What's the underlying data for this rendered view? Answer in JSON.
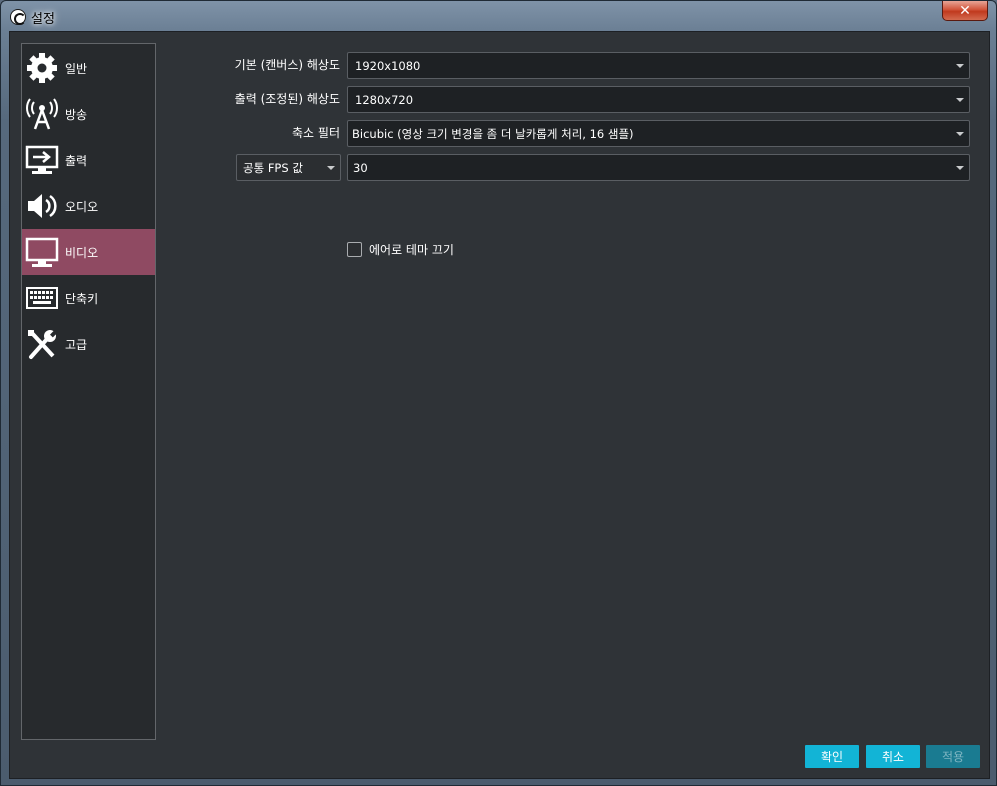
{
  "window": {
    "title": "설정",
    "close_symbol": "✕"
  },
  "sidebar": {
    "items": [
      {
        "label": "일반",
        "icon": "gear-icon",
        "active": false
      },
      {
        "label": "방송",
        "icon": "broadcast-antenna-icon",
        "active": false
      },
      {
        "label": "출력",
        "icon": "output-monitor-icon",
        "active": false
      },
      {
        "label": "오디오",
        "icon": "speaker-icon",
        "active": false
      },
      {
        "label": "비디오",
        "icon": "monitor-icon",
        "active": true
      },
      {
        "label": "단축키",
        "icon": "keyboard-icon",
        "active": false
      },
      {
        "label": "고급",
        "icon": "tools-icon",
        "active": false
      }
    ]
  },
  "video": {
    "base_resolution": {
      "label": "기본 (캔버스) 해상도",
      "value": "1920x1080"
    },
    "output_resolution": {
      "label": "출력 (조정된) 해상도",
      "value": "1280x720"
    },
    "downscale_filter": {
      "label": "축소 필터",
      "value": "Bicubic (영상 크기 변경을 좀 더 날카롭게 처리, 16 샘플)"
    },
    "fps": {
      "type_value": "공통 FPS 값",
      "value": "30"
    },
    "disable_aero": {
      "label": "에어로 테마 끄기",
      "checked": false
    }
  },
  "buttons": {
    "ok": "확인",
    "cancel": "취소",
    "apply": "적용"
  },
  "colors": {
    "accent": "#12b4d6",
    "active_item": "#8f4a62",
    "panel_bg": "#2f3337"
  }
}
